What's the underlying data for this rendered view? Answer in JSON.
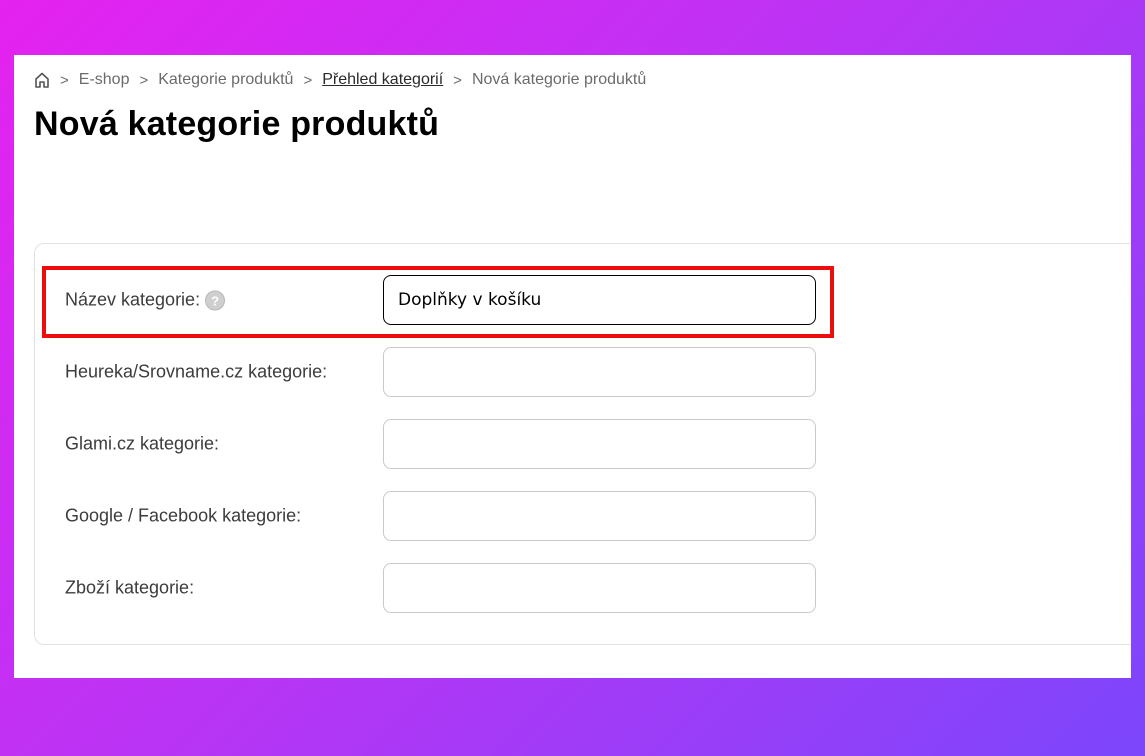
{
  "breadcrumb": {
    "items": [
      "E-shop",
      "Kategorie produktů",
      "Přehled kategorií",
      "Nová kategorie produktů"
    ],
    "separator": ">"
  },
  "page": {
    "title": "Nová kategorie produktů"
  },
  "form": {
    "fields": [
      {
        "label": "Název kategorie:",
        "value": "Doplňky v košíku",
        "help": "?"
      },
      {
        "label": "Heureka/Srovname.cz kategorie:",
        "value": ""
      },
      {
        "label": "Glami.cz kategorie:",
        "value": ""
      },
      {
        "label": "Google / Facebook kategorie:",
        "value": ""
      },
      {
        "label": "Zboží kategorie:",
        "value": ""
      }
    ]
  },
  "colors": {
    "highlight": "#ee0d0d",
    "background_start": "#e522f0",
    "background_end": "#7c46fb"
  }
}
